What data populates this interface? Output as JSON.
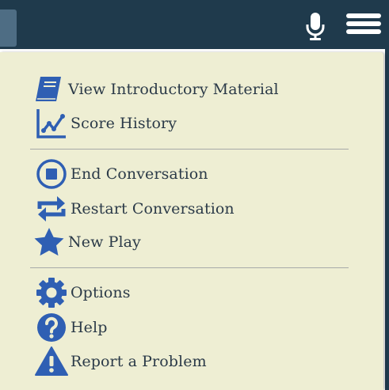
{
  "colors": {
    "header_bg": "#1f3a4c",
    "menu_bg": "#eeeed3",
    "icon_blue": "#2f5fb3",
    "text": "#2b3a48",
    "divider": "#a7a9a8"
  },
  "header": {
    "mic_icon": "microphone-icon",
    "menu_icon": "hamburger-menu-icon"
  },
  "menu": {
    "groups": [
      {
        "items": [
          {
            "label": "View Introductory Material",
            "icon": "book-icon"
          },
          {
            "label": "Score History",
            "icon": "line-chart-icon"
          }
        ]
      },
      {
        "items": [
          {
            "label": "End Conversation",
            "icon": "stop-circle-icon"
          },
          {
            "label": "Restart Conversation",
            "icon": "repeat-icon"
          },
          {
            "label": "New Play",
            "icon": "star-icon"
          }
        ]
      },
      {
        "items": [
          {
            "label": "Options",
            "icon": "gear-icon"
          },
          {
            "label": "Help",
            "icon": "question-circle-icon"
          },
          {
            "label": "Report a Problem",
            "icon": "warning-triangle-icon"
          }
        ]
      }
    ]
  }
}
